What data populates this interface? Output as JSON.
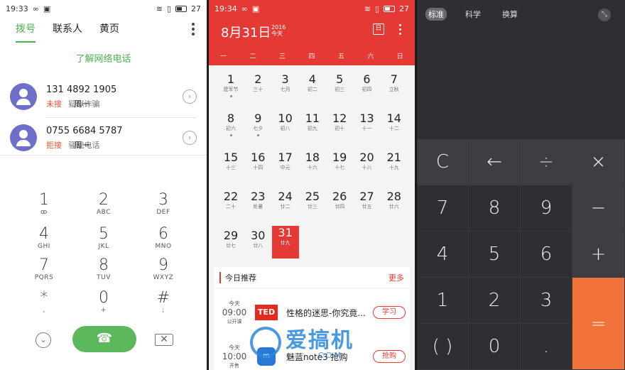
{
  "dialer": {
    "status": {
      "time": "19:33",
      "battery": "27"
    },
    "tabs": [
      {
        "label": "拨号"
      },
      {
        "label": "联系人"
      },
      {
        "label": "黄页"
      }
    ],
    "net_call_link": "了解网络电话",
    "calls": [
      {
        "number": "131 4892 1905",
        "status": "未接",
        "day": "周一",
        "note": "疑似诈骗"
      },
      {
        "number": "0755 6684 5787",
        "status": "拒接",
        "day": "周一",
        "note": "骚扰电话"
      }
    ],
    "keys": [
      {
        "digit": "1",
        "letters": "ꝏ"
      },
      {
        "digit": "2",
        "letters": "ABC"
      },
      {
        "digit": "3",
        "letters": "DEF"
      },
      {
        "digit": "4",
        "letters": "GHI"
      },
      {
        "digit": "5",
        "letters": "JKL"
      },
      {
        "digit": "6",
        "letters": "MNO"
      },
      {
        "digit": "7",
        "letters": "PQRS"
      },
      {
        "digit": "8",
        "letters": "TUV"
      },
      {
        "digit": "9",
        "letters": "WXYZ"
      },
      {
        "digit": "*",
        "letters": ","
      },
      {
        "digit": "0",
        "letters": "+"
      },
      {
        "digit": "#",
        "letters": ";"
      }
    ],
    "call_icon": "☎",
    "collapse_icon": "⌄",
    "backspace_icon": "✕"
  },
  "calendar": {
    "status": {
      "time": "19:34",
      "battery": "27"
    },
    "title": "8月31日",
    "year": "2016",
    "today_label": "今天",
    "weekdays": [
      "一",
      "二",
      "三",
      "四",
      "五",
      "六",
      "日"
    ],
    "days": [
      {
        "n": "1",
        "sub": "建军节"
      },
      {
        "n": "2",
        "sub": "三十"
      },
      {
        "n": "3",
        "sub": "七月"
      },
      {
        "n": "4",
        "sub": "初二"
      },
      {
        "n": "5",
        "sub": "初三"
      },
      {
        "n": "6",
        "sub": "初四"
      },
      {
        "n": "7",
        "sub": "立秋"
      },
      {
        "n": "8",
        "sub": "初六"
      },
      {
        "n": "9",
        "sub": "七夕"
      },
      {
        "n": "10",
        "sub": "初八"
      },
      {
        "n": "11",
        "sub": "初九"
      },
      {
        "n": "12",
        "sub": "初十"
      },
      {
        "n": "13",
        "sub": "十一"
      },
      {
        "n": "14",
        "sub": "十二"
      },
      {
        "n": "15",
        "sub": "十三"
      },
      {
        "n": "16",
        "sub": "十四"
      },
      {
        "n": "17",
        "sub": "中元"
      },
      {
        "n": "18",
        "sub": "十六"
      },
      {
        "n": "19",
        "sub": "十七"
      },
      {
        "n": "20",
        "sub": "十八"
      },
      {
        "n": "21",
        "sub": "十九"
      },
      {
        "n": "22",
        "sub": "二十"
      },
      {
        "n": "23",
        "sub": "处暑"
      },
      {
        "n": "24",
        "sub": "廿二"
      },
      {
        "n": "25",
        "sub": "廿三"
      },
      {
        "n": "26",
        "sub": "廿四"
      },
      {
        "n": "27",
        "sub": "廿五"
      },
      {
        "n": "28",
        "sub": "廿六"
      },
      {
        "n": "29",
        "sub": "廿七"
      },
      {
        "n": "30",
        "sub": "廿八"
      },
      {
        "n": "31",
        "sub": "廿九"
      }
    ],
    "recommend": {
      "title": "今日推荐",
      "more": "更多",
      "items": [
        {
          "when": "今天",
          "time": "09:00",
          "tag": "公开课",
          "logo": "TED",
          "name": "性格的迷思-你究竟...",
          "action": "学习"
        },
        {
          "when": "今天",
          "time": "10:00",
          "tag": "开售",
          "logo": "m",
          "name": "魅蓝note3 抢购",
          "action": "抢购"
        }
      ]
    },
    "watermark": {
      "text": "爱搞机",
      "sub": "COM"
    }
  },
  "calculator": {
    "modes": [
      "标准",
      "科学",
      "换算"
    ],
    "keys": [
      {
        "label": "C",
        "kind": "op"
      },
      {
        "label": "←",
        "kind": "op"
      },
      {
        "label": "÷",
        "kind": "op"
      },
      {
        "label": "×",
        "kind": "op"
      },
      {
        "label": "7",
        "kind": "num"
      },
      {
        "label": "8",
        "kind": "num"
      },
      {
        "label": "9",
        "kind": "num"
      },
      {
        "label": "−",
        "kind": "op"
      },
      {
        "label": "4",
        "kind": "num"
      },
      {
        "label": "5",
        "kind": "num"
      },
      {
        "label": "6",
        "kind": "num"
      },
      {
        "label": "+",
        "kind": "op"
      },
      {
        "label": "1",
        "kind": "num"
      },
      {
        "label": "2",
        "kind": "num"
      },
      {
        "label": "3",
        "kind": "num"
      },
      {
        "label": "( )",
        "kind": "num"
      },
      {
        "label": "0",
        "kind": "num"
      },
      {
        "label": ".",
        "kind": "num"
      },
      {
        "label": "=",
        "kind": "eq"
      }
    ],
    "collapse_icon": "⤡",
    "colors": {
      "equals": "#f0733a",
      "background": "#2f2f33"
    }
  }
}
